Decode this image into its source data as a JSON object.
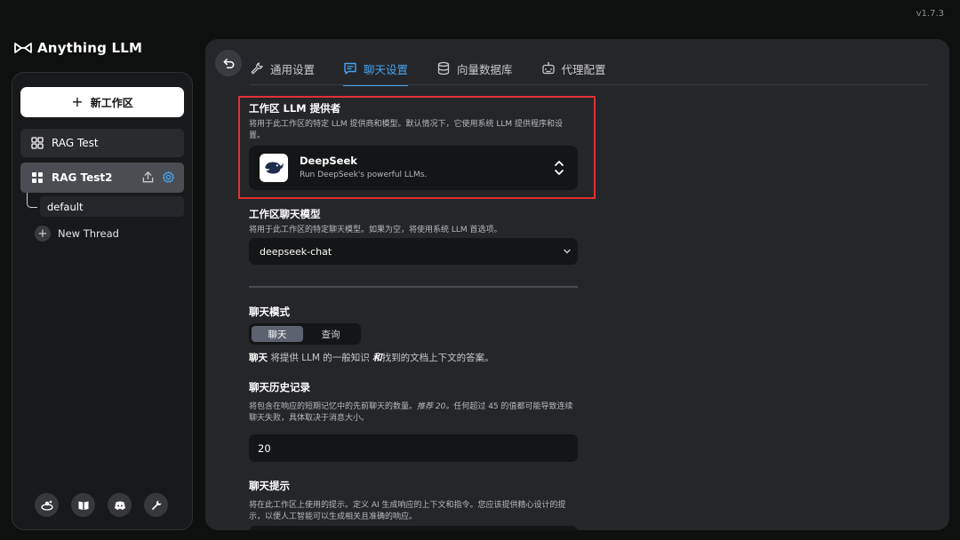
{
  "app": {
    "version": "v1.7.3",
    "brand": "Anything LLM"
  },
  "sidebar": {
    "new_workspace_label": "新工作区",
    "workspaces": [
      {
        "name": "RAG Test"
      },
      {
        "name": "RAG Test2"
      }
    ],
    "threads": [
      {
        "name": "default"
      }
    ],
    "new_thread_label": "New Thread",
    "footer_icons": [
      "community-hub-icon",
      "docs-book-icon",
      "discord-icon",
      "wrench-icon"
    ]
  },
  "tabs": [
    {
      "label": "通用设置",
      "icon": "wrench-icon"
    },
    {
      "label": "聊天设置",
      "icon": "chat-icon",
      "active": true
    },
    {
      "label": "向量数据库",
      "icon": "database-icon"
    },
    {
      "label": "代理配置",
      "icon": "robot-icon"
    }
  ],
  "settings": {
    "provider": {
      "title": "工作区 LLM 提供者",
      "description": "将用于此工作区的特定 LLM 提供商和模型。默认情况下，它使用系统 LLM 提供程序和设置。",
      "selected_name": "DeepSeek",
      "selected_description": "Run DeepSeek's powerful LLMs."
    },
    "model": {
      "title": "工作区聊天模型",
      "description": "将用于此工作区的特定聊天模型。如果为空，将使用系统 LLM 首选项。",
      "value": "deepseek-chat"
    },
    "chat_mode": {
      "title": "聊天模式",
      "options": [
        "聊天",
        "查询"
      ],
      "selected": "聊天",
      "help_bold": "聊天",
      "help_part1": " 将提供 LLM 的一般知识 ",
      "help_bold2": "和",
      "help_part2": "找到的文档上下文的答案。"
    },
    "history": {
      "title": "聊天历史记录",
      "description_part1": "将包含在响应的短期记忆中的先前聊天的数量。",
      "description_italic": "推荐 20。",
      "description_part2": "任何超过 45 的值都可能导致连续聊天失败，具体取决于消息大小。",
      "value": "20"
    },
    "prompt": {
      "title": "聊天提示",
      "description": "将在此工作区上使用的提示。定义 AI 生成响应的上下文和指令。您应该提供精心设计的提示，以便人工智能可以生成相关且准确的响应。"
    }
  },
  "colors": {
    "accent": "#46a4f0",
    "highlight_border": "#e03131",
    "panel": "#25262a",
    "field": "#141516"
  }
}
